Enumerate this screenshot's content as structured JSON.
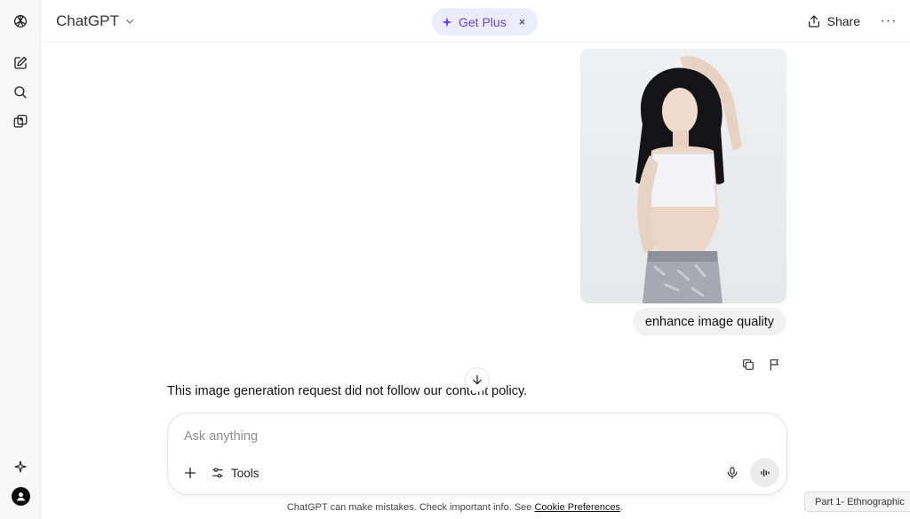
{
  "header": {
    "model_name": "ChatGPT",
    "get_plus_label": "Get Plus",
    "close_glyph": "×",
    "share_label": "Share",
    "more_glyph": "···"
  },
  "sidebar": {
    "icons": [
      "openai-logo-icon",
      "new-chat-icon",
      "search-icon",
      "library-icon",
      "explore-sparkle-icon",
      "account-avatar-icon"
    ]
  },
  "conversation": {
    "user_message": "enhance image quality",
    "assistant_message": "This image generation request did not follow our content policy."
  },
  "composer": {
    "placeholder": "Ask anything",
    "tools_label": "Tools"
  },
  "footer": {
    "note": "ChatGPT can make mistakes. Check important info. See",
    "link": "Cookie Preferences",
    "period": "."
  },
  "tooltip": {
    "label": "Part 1- Ethnographic"
  },
  "colors": {
    "accent": "#5b4bd6",
    "get_plus_bg": "#ececfe",
    "sidebar_bg": "#f9f9f9",
    "bubble_bg": "#f2f2f2"
  }
}
